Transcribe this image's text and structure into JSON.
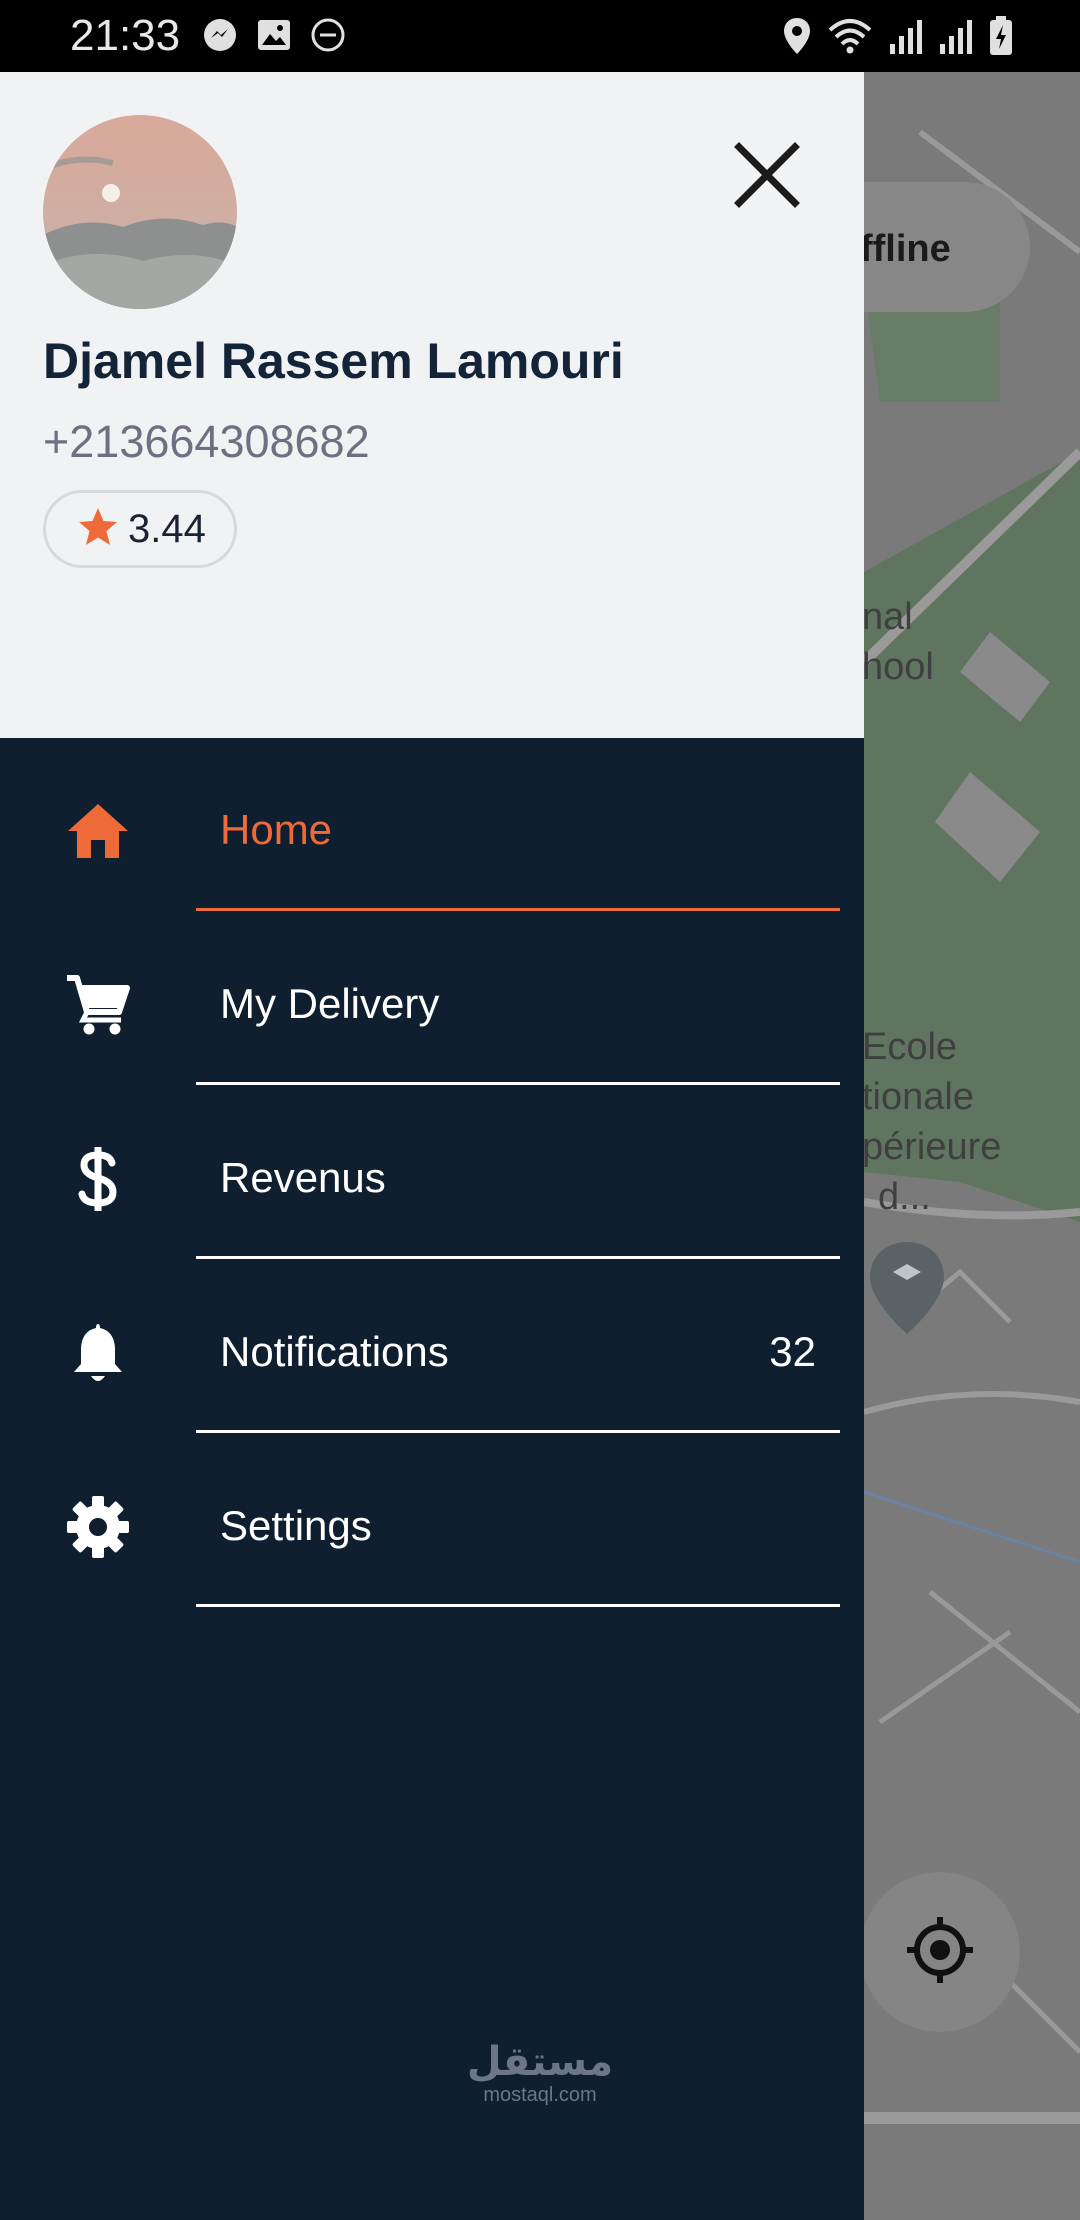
{
  "status_bar": {
    "time": "21:33",
    "left_icons": [
      "messenger-icon",
      "image-icon",
      "do-not-disturb-icon"
    ],
    "right_icons": [
      "location-icon",
      "wifi-icon",
      "signal-icon",
      "signal-icon",
      "battery-charging-icon"
    ]
  },
  "map": {
    "status_label": "ffline",
    "labels": [
      "nal",
      "hool",
      "Ecole",
      "tionale",
      "périeure",
      "d..."
    ],
    "colors": {
      "background": "#7a7a7a",
      "park": "#5f7560",
      "road": "#9a9a9a"
    }
  },
  "profile": {
    "name": "Djamel Rassem Lamouri",
    "phone": "+213664308682",
    "rating": "3.44"
  },
  "menu": [
    {
      "label": "Home",
      "icon": "home-icon",
      "active": true
    },
    {
      "label": "My Delivery",
      "icon": "cart-icon",
      "active": false
    },
    {
      "label": "Revenus",
      "icon": "dollar-icon",
      "active": false
    },
    {
      "label": "Notifications",
      "icon": "bell-icon",
      "active": false,
      "count": "32"
    },
    {
      "label": "Settings",
      "icon": "gear-icon",
      "active": false
    }
  ],
  "watermark": {
    "text": "مستقل",
    "sub": "mostaql.com"
  },
  "colors": {
    "accent": "#ef6a39",
    "drawer_bg": "#0f1f30",
    "header_bg": "#f1f2f4",
    "name_text": "#132338"
  }
}
